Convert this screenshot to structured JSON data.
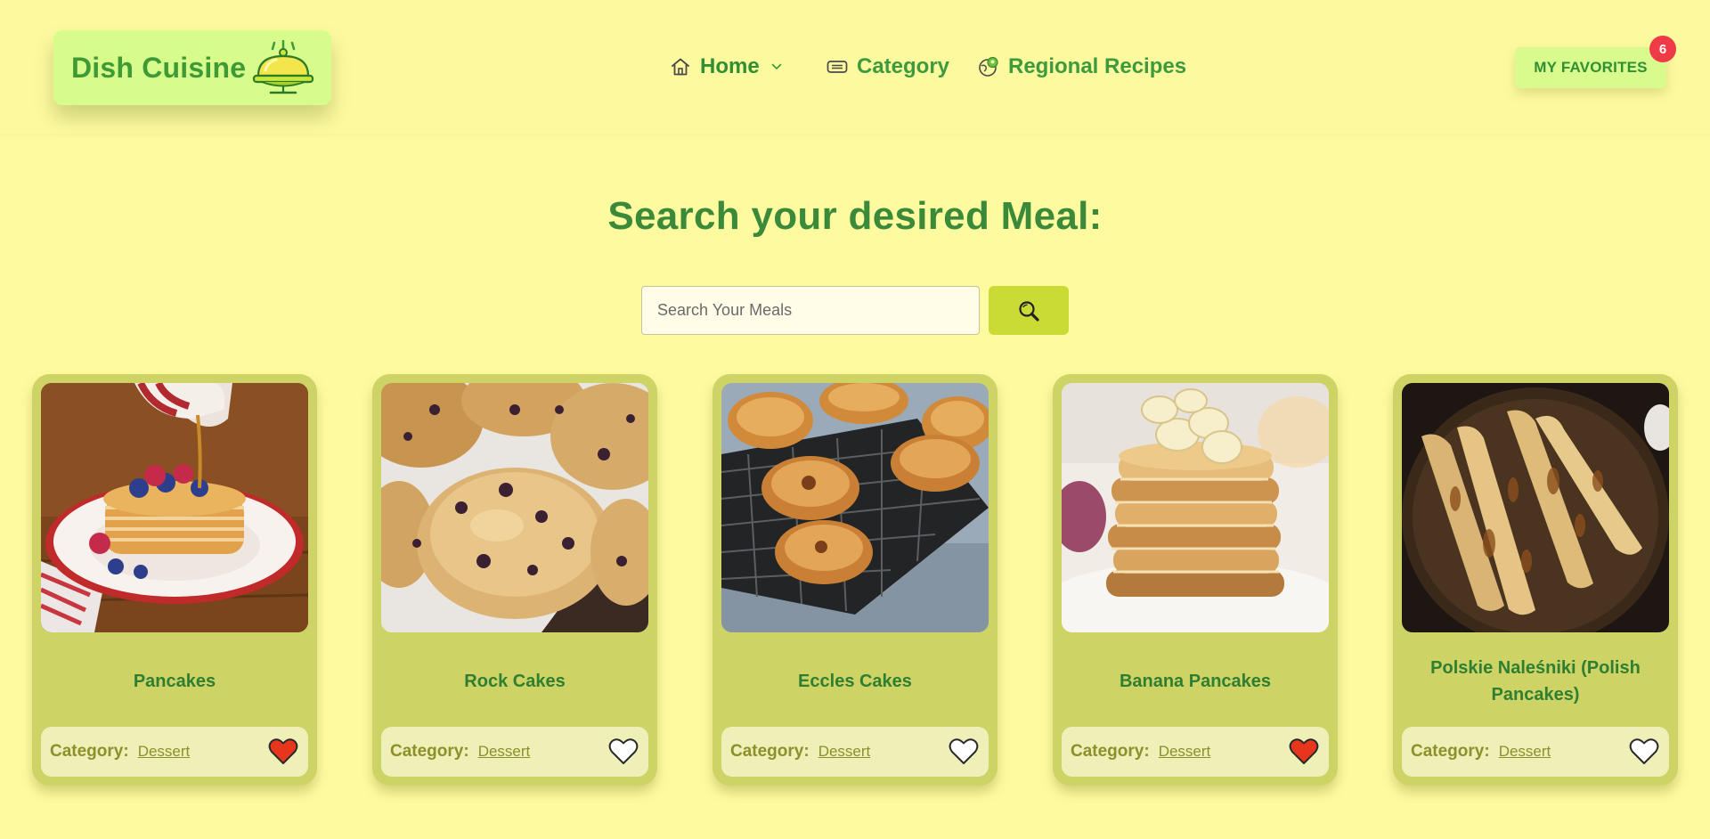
{
  "header": {
    "logo_text": "Dish Cuisine",
    "nav": [
      {
        "label": "Home",
        "icon": "home-icon"
      },
      {
        "label": "Category",
        "icon": "category-icon"
      },
      {
        "label": "Regional Recipes",
        "icon": "globe-icon"
      }
    ],
    "favorites_label": "MY FAVORITES",
    "favorites_count": "6"
  },
  "search": {
    "heading": "Search your desired Meal:",
    "placeholder": "Search Your Meals",
    "button_icon": "search-icon"
  },
  "card_category_label": "Category:",
  "cards": [
    {
      "title": "Pancakes",
      "category": "Dessert",
      "favorite": true
    },
    {
      "title": "Rock Cakes",
      "category": "Dessert",
      "favorite": false
    },
    {
      "title": "Eccles Cakes",
      "category": "Dessert",
      "favorite": false
    },
    {
      "title": "Banana Pancakes",
      "category": "Dessert",
      "favorite": true
    },
    {
      "title": "Polskie Naleśniki (Polish Pancakes)",
      "category": "Dessert",
      "favorite": false
    }
  ],
  "colors": {
    "background": "#fefaa0",
    "logo_bg": "#d8fc8c",
    "brand_green": "#3e9a35",
    "card_bg": "#cdd365",
    "search_button": "#cbdb35",
    "heart_filled": "#e8361c",
    "badge": "#ef3b47"
  }
}
